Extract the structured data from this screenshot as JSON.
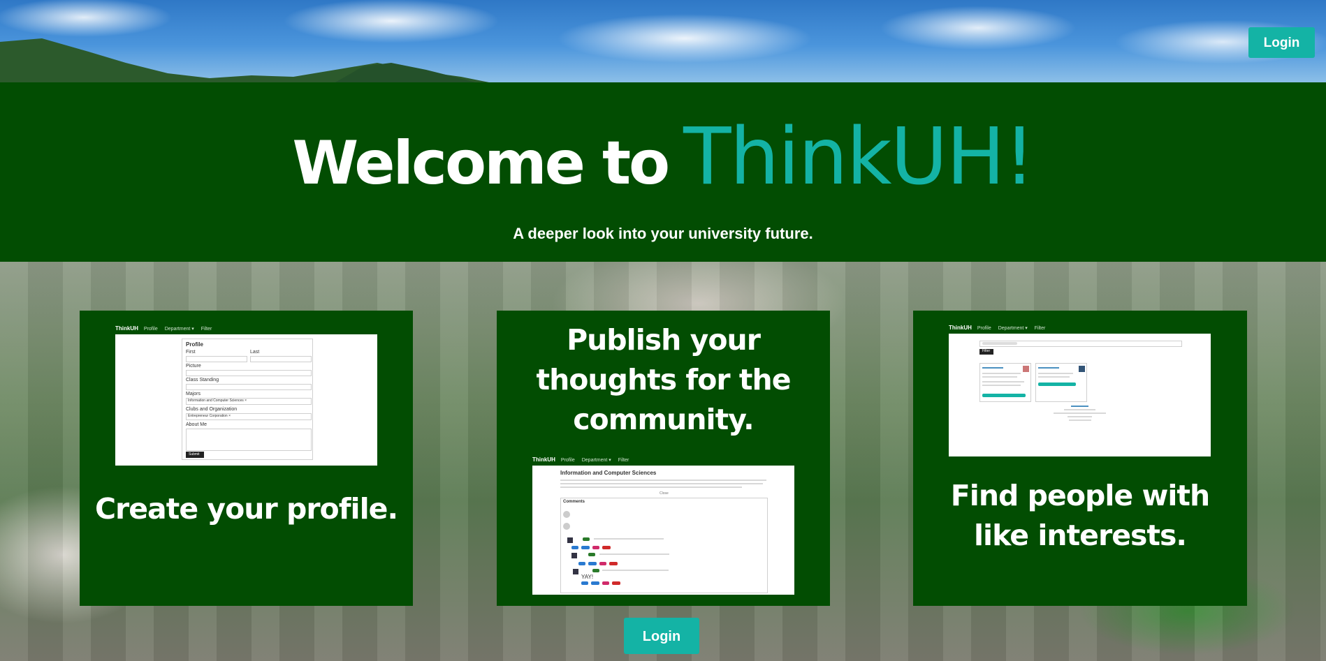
{
  "header": {
    "login_label": "Login"
  },
  "hero": {
    "welcome_text": "Welcome to",
    "brand_text": "ThinkUH!",
    "subtitle": "A deeper look into your university future."
  },
  "cards": [
    {
      "caption": "Create your profile.",
      "preview": {
        "nav_brand": "ThinkUH",
        "nav_items": [
          "Profile",
          "Department ▾",
          "Filter"
        ],
        "heading": "Profile",
        "fields": [
          "First",
          "Last",
          "Picture",
          "Class Standing",
          "Majors",
          "Clubs and Organization",
          "About Me"
        ],
        "tags": [
          "Information and Computer Sciences ×",
          "Entrepreneur Corporation ×"
        ],
        "submit_label": "Submit"
      }
    },
    {
      "caption": "Publish your thoughts for the community.",
      "preview": {
        "nav_brand": "ThinkUH",
        "nav_items": [
          "Profile",
          "Department ▾",
          "Filter"
        ],
        "heading": "Information and Computer Sciences",
        "close_label": "Close",
        "comments_label": "Comments",
        "reply_text": "YAY!"
      }
    },
    {
      "caption": "Find people with like interests.",
      "preview": {
        "nav_brand": "ThinkUH",
        "nav_items": [
          "Profile",
          "Department ▾",
          "Filter"
        ],
        "filter_label": "Filter"
      }
    }
  ],
  "footer": {
    "login_label": "Login"
  },
  "colors": {
    "hero_background": "#024d02",
    "accent": "#14b3a5",
    "text": "#ffffff"
  }
}
